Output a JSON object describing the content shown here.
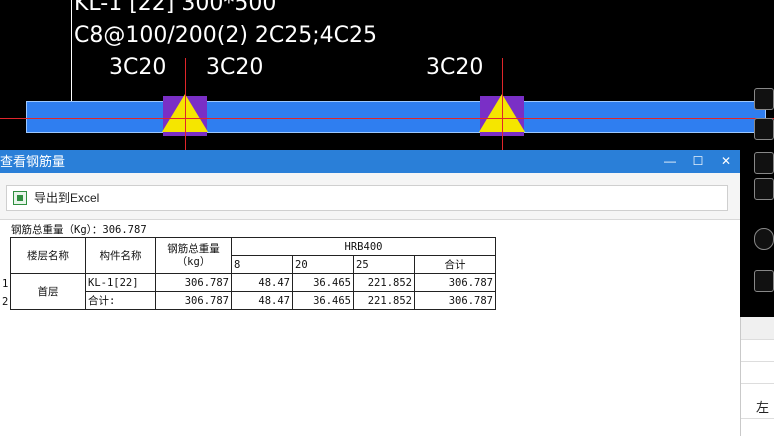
{
  "cad": {
    "beam_label": "KL-1 [22] 300*500",
    "stirrup_text": "C8@100/200(2) 2C25;4C25",
    "support_labels": [
      "3C20",
      "3C20",
      "3C20"
    ]
  },
  "window": {
    "title": "查看钢筋量",
    "minimize": "—",
    "maximize": "☐",
    "close": "✕"
  },
  "toolbar": {
    "export_label": "导出到Excel"
  },
  "summary": {
    "total_weight_text": "钢筋总重量（Kg）：306.787"
  },
  "table": {
    "headers": {
      "floor": "楼层名称",
      "member": "构件名称",
      "weight_line1": "钢筋总重量",
      "weight_line2": "（kg）",
      "grade": "HRB400",
      "d8": "8",
      "d20": "20",
      "d25": "25",
      "subtotal": "合计"
    },
    "floor": "首层",
    "rows": [
      {
        "num": "1",
        "member": "KL-1[22]",
        "weight": "306.787",
        "d8": "48.47",
        "d20": "36.465",
        "d25": "221.852",
        "subtotal": "306.787"
      },
      {
        "num": "2",
        "member": "合计:",
        "weight": "306.787",
        "d8": "48.47",
        "d20": "36.465",
        "d25": "221.852",
        "subtotal": "306.787"
      }
    ]
  },
  "right_panel": {
    "row_label": "左"
  },
  "colors": {
    "titlebar": "#2a7fd8",
    "beam": "#2f7ef0",
    "column": "#7a2fc6",
    "support": "#f5e600",
    "axis": "#e0262a"
  }
}
